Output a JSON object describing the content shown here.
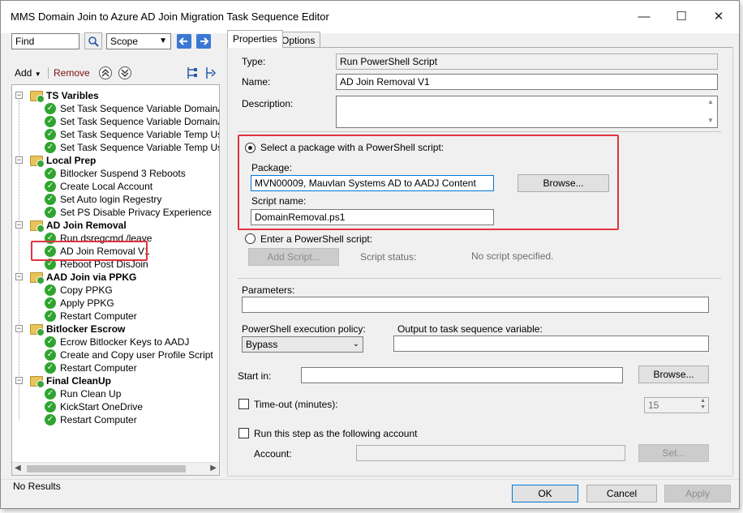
{
  "window": {
    "title": "MMS Domain Join to Azure AD Join Migration Task Sequence Editor",
    "controls": {
      "minimize": "—",
      "maximize": "☐",
      "close": "✕"
    }
  },
  "search": {
    "value": "Find",
    "scope_value": "Scope",
    "search_icon": "magnifier-icon",
    "back_icon": "arrow-left-icon",
    "forward_icon": "arrow-right-icon"
  },
  "toolbar": {
    "add_label": "Add",
    "remove_label": "Remove"
  },
  "tree": {
    "groups": [
      {
        "label": "TS Varibles",
        "items": [
          "Set Task Sequence Variable DomainAdm",
          "Set Task Sequence Variable DomainAdm",
          "Set Task Sequence Variable Temp User",
          "Set Task Sequence Variable Temp User I"
        ]
      },
      {
        "label": "Local Prep",
        "items": [
          "Bitlocker Suspend 3 Reboots",
          "Create Local Account",
          "Set Auto login Regestry",
          "Set PS Disable Privacy Experience"
        ]
      },
      {
        "label": "AD Join Removal",
        "items": [
          "Run dsregcmd /leave",
          "AD Join Removal V1",
          "Reboot Post DisJoin"
        ]
      },
      {
        "label": "AAD Join via PPKG",
        "items": [
          "Copy PPKG",
          "Apply PPKG",
          "Restart Computer"
        ]
      },
      {
        "label": "Bitlocker Escrow",
        "items": [
          "Ecrow Bitlocker Keys to AADJ",
          "Create and Copy user Profile Script",
          "Restart Computer"
        ]
      },
      {
        "label": "Final CleanUp",
        "items": [
          "Run Clean Up",
          "KickStart OneDrive",
          "Restart Computer"
        ]
      }
    ]
  },
  "status_bar": {
    "text": "No Results"
  },
  "tabs": [
    {
      "label": "Properties",
      "active": true
    },
    {
      "label": "Options",
      "active": false
    }
  ],
  "properties": {
    "type_label": "Type:",
    "type_value": "Run PowerShell Script",
    "name_label": "Name:",
    "name_value": "AD Join Removal V1",
    "description_label": "Description:",
    "description_value": "",
    "select_package_label": "Select a package with a PowerShell script:",
    "package_label": "Package:",
    "package_value": "MVN00009, Mauvlan Systems AD to AADJ Content",
    "browse_label": "Browse...",
    "script_name_label": "Script name:",
    "script_name_value": "DomainRemoval.ps1",
    "enter_script_label": "Enter a PowerShell script:",
    "add_script_label": "Add Script...",
    "script_status_label": "Script status:",
    "script_status_value": "No script specified.",
    "parameters_label": "Parameters:",
    "parameters_value": "",
    "exec_policy_label": "PowerShell execution policy:",
    "exec_policy_value": "Bypass",
    "output_var_label": "Output to task sequence variable:",
    "output_var_value": "",
    "start_in_label": "Start in:",
    "start_in_value": "",
    "browse2_label": "Browse...",
    "timeout_label": "Time-out (minutes):",
    "timeout_value": "15",
    "run_as_label": "Run this step as the following account",
    "account_label": "Account:",
    "account_value": "",
    "set_label": "Set..."
  },
  "footer": {
    "ok_label": "OK",
    "cancel_label": "Cancel",
    "apply_label": "Apply"
  },
  "colors": {
    "highlight_box": "#e0343f",
    "check_green": "#2fa52f",
    "link_blue": "#0078d7"
  }
}
